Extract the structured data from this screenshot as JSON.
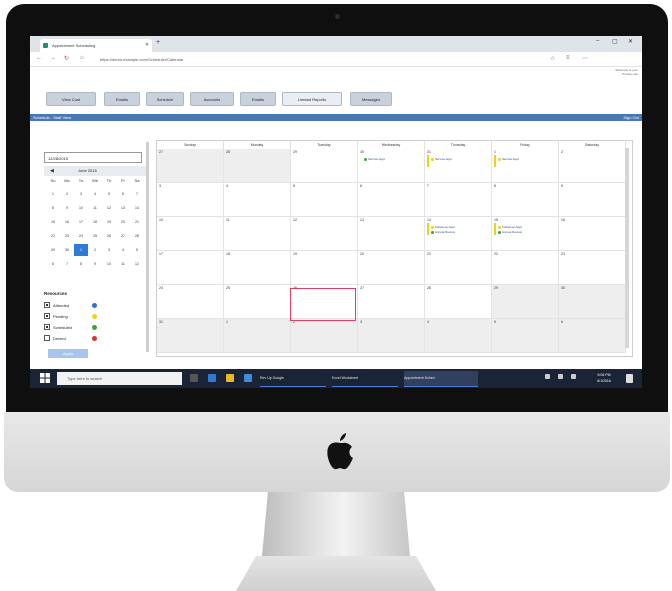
{
  "browser": {
    "tab_title": "Appointment Scheduling",
    "url": "https://demo.example.com/Scheduler/Calendar",
    "profile_text": "Welcome to your\nPrimary site"
  },
  "app_nav": {
    "items": [
      "View Cust",
      "Emails",
      "Schedule",
      "Accounts",
      "Emails",
      "Unread Reports",
      "Messages"
    ]
  },
  "header": {
    "left": "Schedule - Staff View",
    "right": "Sign Out"
  },
  "left_panel": {
    "date_input": "12/28/2015",
    "mini_cal": {
      "month_label": "June 2016",
      "days_of_week": [
        "Su",
        "Mo",
        "Tu",
        "We",
        "Th",
        "Fr",
        "Sa"
      ],
      "weeks": [
        [
          "1",
          "2",
          "3",
          "4",
          "5",
          "6",
          "7"
        ],
        [
          "8",
          "9",
          "10",
          "11",
          "12",
          "13",
          "14"
        ],
        [
          "15",
          "16",
          "17",
          "18",
          "19",
          "20",
          "21"
        ],
        [
          "22",
          "23",
          "24",
          "25",
          "26",
          "27",
          "28"
        ],
        [
          "29",
          "30",
          "1",
          "2",
          "3",
          "4",
          "5"
        ],
        [
          "6",
          "7",
          "8",
          "9",
          "10",
          "11",
          "12"
        ]
      ],
      "selected": "1"
    },
    "legend": {
      "title": "Resources",
      "items": [
        {
          "label": "Attended",
          "checked": true,
          "color": "#2e6fcf"
        },
        {
          "label": "Pending",
          "checked": true,
          "color": "#e8d320"
        },
        {
          "label": "Scheduled",
          "checked": true,
          "color": "#3aa03a"
        },
        {
          "label": "Denied",
          "checked": false,
          "color": "#d9342b"
        }
      ]
    },
    "apply_button": "Apply"
  },
  "calendar": {
    "days": [
      "Sunday",
      "Monday",
      "Tuesday",
      "Wednesday",
      "Thursday",
      "Friday",
      "Saturday"
    ],
    "weeks": [
      [
        "27",
        "28",
        "29",
        "30",
        "31",
        "1",
        "2"
      ],
      [
        "3",
        "4",
        "5",
        "6",
        "7",
        "8",
        "9"
      ],
      [
        "10",
        "11",
        "12",
        "13",
        "14",
        "15",
        "16"
      ],
      [
        "17",
        "18",
        "19",
        "20",
        "21",
        "22",
        "23"
      ],
      [
        "24",
        "25",
        "26",
        "27",
        "28",
        "29",
        "30"
      ],
      [
        "31",
        "1",
        "2",
        "3",
        "4",
        "5",
        "6"
      ]
    ],
    "events": [
      {
        "week": 0,
        "day": 3,
        "text": "Service Appt",
        "color": "#3aa03a"
      },
      {
        "week": 0,
        "day": 4,
        "text": "Service Appt",
        "color": "#e8d320"
      },
      {
        "week": 0,
        "day": 5,
        "text": "Service Appt",
        "color": "#e8d320"
      },
      {
        "week": 2,
        "day": 4,
        "text": "Follow-up Appt",
        "color": "#e8d320"
      },
      {
        "week": 2,
        "day": 4,
        "text": "Annual Review",
        "color": "#3aa03a"
      },
      {
        "week": 2,
        "day": 5,
        "text": "Follow-up Appt",
        "color": "#e8d320"
      },
      {
        "week": 2,
        "day": 5,
        "text": "Annual Review",
        "color": "#3aa03a"
      }
    ]
  },
  "taskbar": {
    "search_placeholder": "Type here to search",
    "apps": [
      "Rev Up Google",
      "Excel Worksheet",
      "Appointment Sched"
    ],
    "clock_time": "5:06 PM",
    "clock_date": "6/1/2016"
  }
}
